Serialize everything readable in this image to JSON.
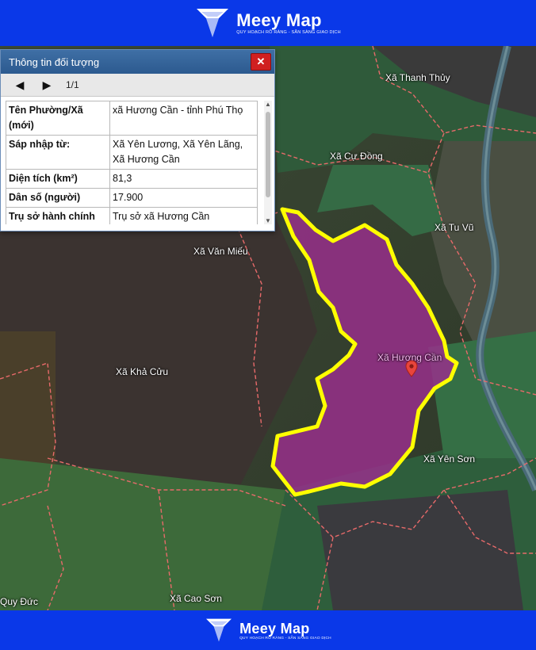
{
  "brand": {
    "name": "Meey Map",
    "tagline": "QUY HOẠCH RÕ RÀNG - SẴN SÀNG GIAO DỊCH"
  },
  "panel": {
    "title": "Thông tin đối tượng",
    "close": "✕",
    "prev_icon": "◀",
    "next_icon": "▶",
    "page": "1/1",
    "rows": [
      {
        "key": "Tên Phường/Xã (mới)",
        "value": "xã Hương Cần - tỉnh Phú Thọ"
      },
      {
        "key": "Sáp nhập từ:",
        "value": "Xã Yên Lương, Xã Yên Lãng, Xã Hương Cần"
      },
      {
        "key": "Diện tích (km²)",
        "value": "81,3"
      },
      {
        "key": "Dân số (người)",
        "value": "17.900"
      },
      {
        "key": "Trụ sở hành chính (mới)",
        "value": "Trụ sở xã Hương Cần"
      }
    ]
  },
  "map": {
    "labels": {
      "thanh_thuy": "Xã Thanh Thủy",
      "cu_dong": "Xã Cự Đồng",
      "tu_vu": "Xã Tu Vũ",
      "van_mieu": "Xã Văn Miếu",
      "huong_can": "Xã Hương Cần",
      "kha_cuu": "Xã Khả Cửu",
      "yen_son": "Xã Yên Sơn",
      "cao_son": "Xã Cao Sơn",
      "quy_duc": "Quy Đức"
    },
    "colors": {
      "highlight_fill": "#9b2e8e",
      "highlight_border": "#ffff00",
      "boundary": "#e86a6a"
    }
  }
}
